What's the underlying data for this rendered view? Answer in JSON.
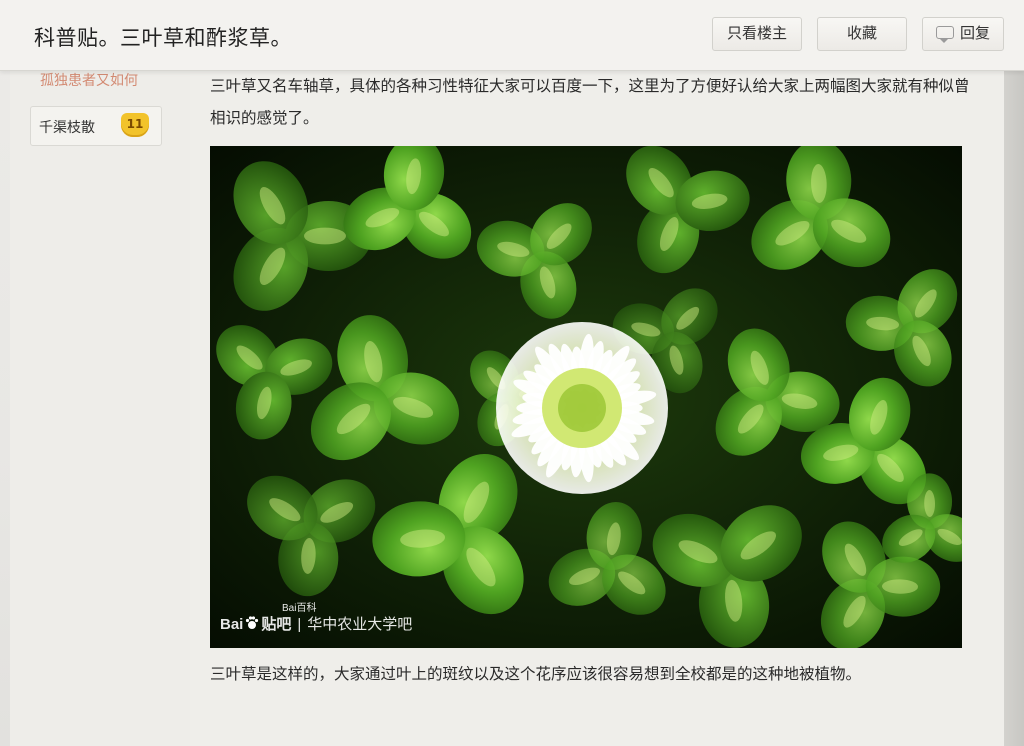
{
  "header": {
    "title": "科普贴。三叶草和酢浆草。",
    "buttons": {
      "only_op": "只看楼主",
      "favorite": "收藏",
      "reply": "回复"
    }
  },
  "author": {
    "top_link": "孤独患者又如何",
    "name": "千渠枝散",
    "level": "11"
  },
  "post": {
    "paragraph1": "三叶草又名车轴草，具体的各种习性特征大家可以百度一下，这里为了方便好认给大家上两幅图大家就有种似曾相识的感觉了。",
    "paragraph2": "三叶草是这样的，大家通过叶上的斑纹以及这个花序应该很容易想到全校都是的这种地被植物。",
    "image": {
      "watermark_brand_a": "Bai",
      "watermark_brand_b": "贴吧",
      "watermark_small": "Bai百科",
      "watermark_sep": "|",
      "watermark_school": "华中农业大学吧"
    }
  },
  "colors": {
    "accent_badge": "#f2c32b",
    "link": "#d38a72",
    "leaf_green": "#5aa82a"
  },
  "icons": {
    "reply": "speech-bubble-icon",
    "level": "level-badge-icon",
    "watermark": "baidu-paw-icon"
  }
}
